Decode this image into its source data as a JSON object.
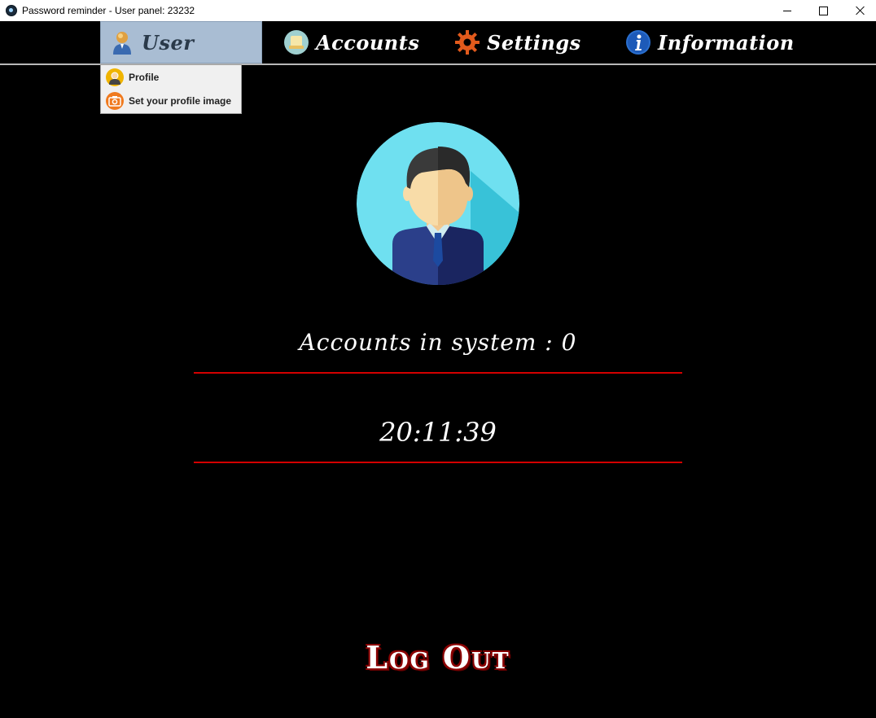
{
  "window": {
    "title": "Password reminder - User panel: 23232",
    "controls": [
      "minimize-icon",
      "maximize-icon",
      "close-icon"
    ]
  },
  "menubar": {
    "items": [
      {
        "label": "User",
        "icon": "user-icon",
        "active": true
      },
      {
        "label": "Accounts",
        "icon": "accounts-icon"
      },
      {
        "label": "Settings",
        "icon": "gear-icon"
      },
      {
        "label": "Information",
        "icon": "info-icon"
      }
    ]
  },
  "user_menu": {
    "items": [
      {
        "label": "Profile",
        "icon": "profile-icon"
      },
      {
        "label": "Set your profile image",
        "icon": "camera-icon"
      }
    ]
  },
  "main": {
    "avatar": "avatar-icon",
    "accounts_text": "Accounts in system : 0",
    "clock": "20:11:39",
    "logout_label": "Log Out"
  },
  "colors": {
    "background": "#000000",
    "active_menu": "#a9bdd3",
    "divider": "#d40000",
    "logout_shadow": "#8b0000"
  }
}
